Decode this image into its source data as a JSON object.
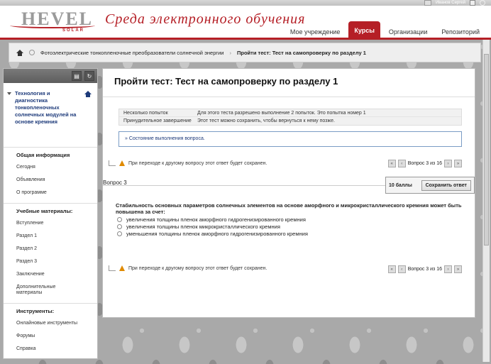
{
  "header": {
    "logo_text": "HEVEL",
    "logo_sub": "SOLAR",
    "site_title": "Среда электронного обучения",
    "user_name": "Иванов Сергей",
    "tabs": [
      {
        "label": "Мое учреждение",
        "active": false
      },
      {
        "label": "Курсы",
        "active": true
      },
      {
        "label": "Организации",
        "active": false
      },
      {
        "label": "Репозиторий",
        "active": false
      }
    ],
    "accent_color": "#b51f26"
  },
  "breadcrumb": {
    "course": "Фотоэлектрические тонкопленочные преобразователи солнечной энергии",
    "separator": "›",
    "current": "Пройти тест: Тест на самопроверку по разделу 1"
  },
  "sidebar": {
    "course_title": "Технология и диагностика тонкопленочных солнечных модулей на основе кремния",
    "sections": [
      {
        "heading": "Общая информация",
        "items": [
          "Сегодня",
          "Объявления",
          "О программе"
        ]
      },
      {
        "heading": "Учебные материалы:",
        "items": [
          "Вступление",
          "Раздел 1",
          "Раздел 2",
          "Раздел 3",
          "Заключение",
          "Дополнительные материалы"
        ]
      },
      {
        "heading": "Инструменты:",
        "items": [
          "Онлайновые инструменты",
          "Форумы",
          "Справка"
        ]
      }
    ]
  },
  "main": {
    "title": "Пройти тест: Тест на самопроверку по разделу 1",
    "info": [
      {
        "key": "Несколько попыток",
        "value": "Для этого теста разрешено выполнение 2 попыток. Это попытка номер 1"
      },
      {
        "key": "Принудительное завершение",
        "value": "Этот тест можно сохранить, чтобы вернуться к нему позже."
      }
    ],
    "status_link": "» Состояние выполнения вопроса.",
    "warning": "При переходе к другому вопросу этот ответ будет сохранен.",
    "pager_text": "Вопрос 3 из 16",
    "question_label": "Вопрос 3",
    "score": "10 баллы",
    "save_label": "Сохранить ответ",
    "question_text": "Стабильность основных параметров солнечных элементов на основе аморфного и микрокристаллического кремния может быть повышена за счет:",
    "answers": [
      "увеличения толщины пленок аморфного гидрогенизированного кремния",
      "увеличения толщины пленок микрокристаллического  кремния",
      "уменьшения толщины пленок аморфного гидрогенизированного кремния"
    ]
  }
}
